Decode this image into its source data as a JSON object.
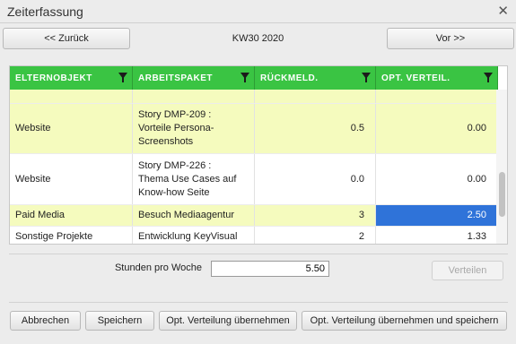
{
  "window": {
    "title": "Zeiterfassung"
  },
  "nav": {
    "back_label": "<< Zurück",
    "week_label": "KW30 2020",
    "next_label": "Vor >>"
  },
  "table": {
    "columns": [
      "ELTERNOBJEKT",
      "ARBEITSPAKET",
      "RÜCKMELD.",
      "OPT. VERTEIL."
    ],
    "rows": [
      {
        "parent": "Website",
        "package_lines": [
          "Story DMP-209 :",
          "Vorteile Persona-",
          "Screenshots"
        ],
        "feedback": "0.5",
        "distribution": "0.00"
      },
      {
        "parent": "Website",
        "package_lines": [
          "Story DMP-226 :",
          "Thema Use Cases auf",
          "Know-how Seite"
        ],
        "feedback": "0.0",
        "distribution": "0.00"
      },
      {
        "parent": "Paid Media",
        "package_lines": [
          "Besuch Mediaagentur"
        ],
        "feedback": "3",
        "distribution": "2.50"
      },
      {
        "parent": "Sonstige Projekte",
        "package_lines": [
          "Entwicklung KeyVisual"
        ],
        "feedback": "2",
        "distribution": "1.33"
      }
    ]
  },
  "hours": {
    "label": "Stunden pro Woche",
    "value": "5.50",
    "distribute_label": "Verteilen"
  },
  "footer": {
    "cancel_label": "Abbrechen",
    "save_label": "Speichern",
    "apply_label": "Opt. Verteilung übernehmen",
    "apply_save_label": "Opt. Verteilung übernehmen und speichern"
  },
  "colors": {
    "header_green": "#3ac443",
    "row_highlight": "#f5fbbe",
    "selection_blue": "#2f73d9"
  }
}
